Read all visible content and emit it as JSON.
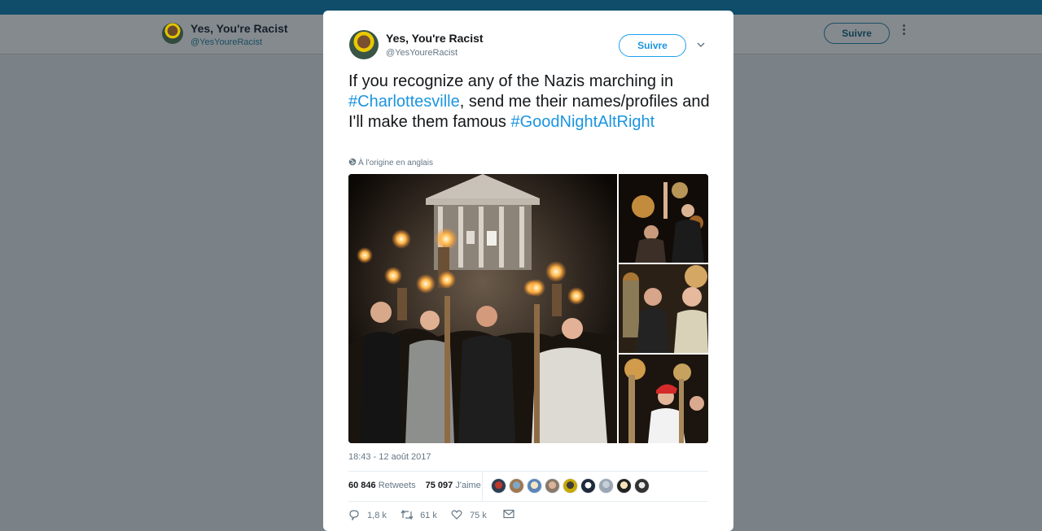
{
  "background_profile": {
    "name": "Yes, You're Racist",
    "handle": "@YesYoureRacist",
    "follow_label": "Suivre"
  },
  "tweet": {
    "author_name": "Yes, You're Racist",
    "author_handle": "@YesYoureRacist",
    "follow_label": "Suivre",
    "text_before": "If you recognize any of the Nazis marching in ",
    "hashtag1": "#Charlottesville",
    "text_middle": ", send me their names/profiles and I'll make them famous ",
    "hashtag2": "#GoodNightAltRight",
    "translation_note": "À l'origine en anglais",
    "timestamp": "18:43 - 12 août 2017",
    "retweets_count": "60 846",
    "retweets_label": "Retweets",
    "likes_count": "75 097",
    "likes_label": "J'aime",
    "reply_count": "1,8 k",
    "retweet_action_count": "61 k",
    "like_action_count": "75 k"
  },
  "icons": {
    "more": "more-dots-icon",
    "caret": "chevron-down-icon",
    "globe": "globe-icon",
    "reply": "reply-icon",
    "retweet": "retweet-icon",
    "like": "heart-icon",
    "message": "envelope-icon"
  },
  "colors": {
    "accent": "#1da1f2",
    "link": "#1b95e0",
    "overlay": "#7b8287",
    "top_strip": "#0f4d6a"
  }
}
